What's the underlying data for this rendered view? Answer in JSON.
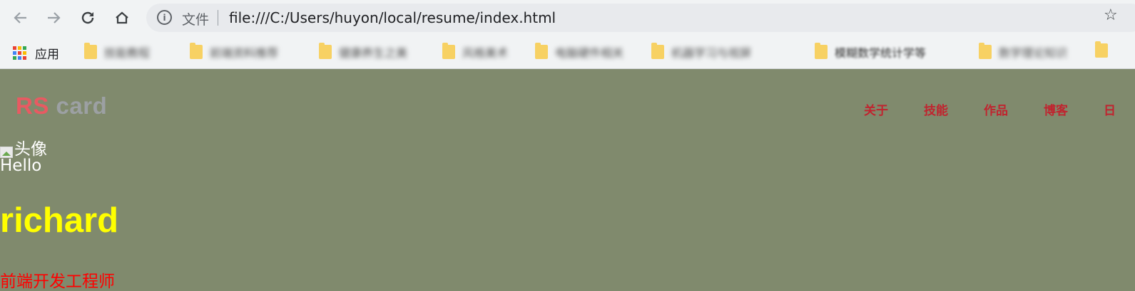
{
  "browser": {
    "scheme_label": "文件",
    "url": "file:///C:/Users/huyon/local/resume/index.html",
    "nav_icons": [
      "back-arrow-icon",
      "forward-arrow-icon",
      "reload-icon",
      "home-icon",
      "info-icon",
      "star-icon"
    ]
  },
  "bookmarks": {
    "apps_label": "应用",
    "apps_colors": [
      "#ea4335",
      "#fbbc04",
      "#34a853",
      "#4285f4",
      "#ea4335",
      "#fbbc04",
      "#34a853",
      "#4285f4",
      "#ea4335"
    ],
    "items": [
      "技能教程",
      "前端资料推荐",
      "健康养生之美",
      "风格美术",
      "电脑硬件相关",
      "机器学习与视屏",
      "模糊数学统计学等",
      "数学理论知识"
    ]
  },
  "page": {
    "logo_prefix": "RS",
    "logo_suffix": "card",
    "nav": [
      "关于",
      "技能",
      "作品",
      "博客",
      "日"
    ],
    "avatar_alt": "头像",
    "greeting": "Hello",
    "name": "richard",
    "role": "前端开发工程师",
    "colors": {
      "background": "#808a6d",
      "logo_rs": "#e85a62",
      "logo_card": "#9ca0a3",
      "nav": "#c0242f",
      "name": "#ffff00",
      "role": "#ff0000"
    }
  }
}
